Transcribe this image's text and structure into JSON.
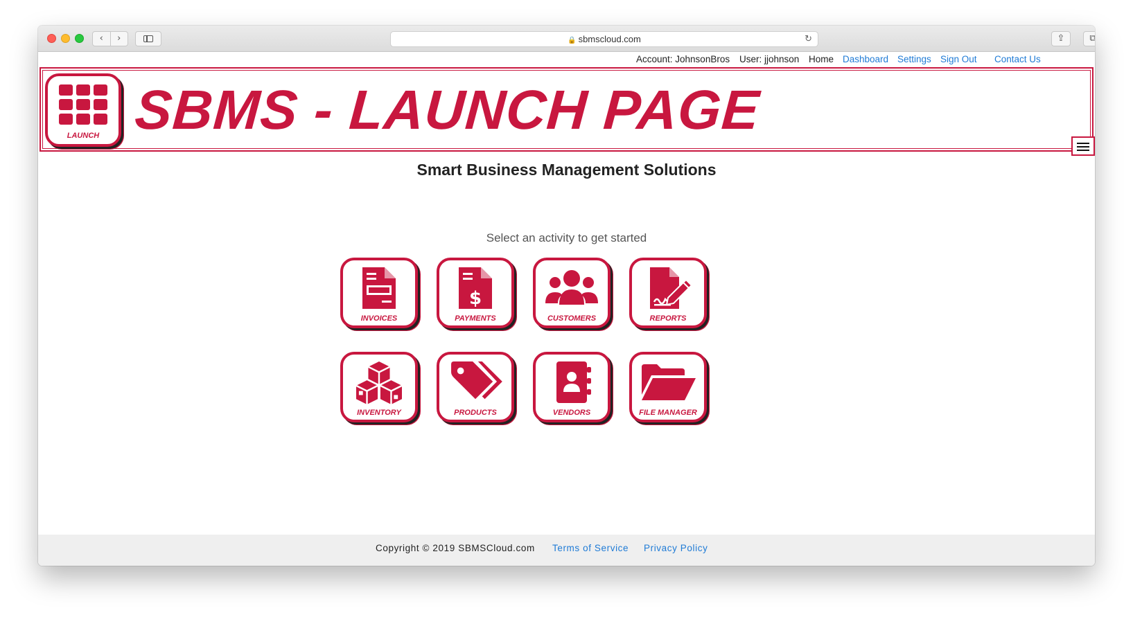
{
  "browser": {
    "url": "sbmscloud.com",
    "back_glyph": "‹",
    "forward_glyph": "›",
    "reload_glyph": "↻",
    "lock_glyph": "🔒",
    "share_glyph": "⇪",
    "tabs_glyph": "⧉",
    "new_tab_glyph": "+"
  },
  "userbar": {
    "account": "Account: JohnsonBros",
    "user": "User: jjohnson",
    "home": "Home",
    "dashboard": "Dashboard",
    "settings": "Settings",
    "sign_out": "Sign Out",
    "contact": "Contact Us"
  },
  "banner": {
    "launch_label": "LAUNCH",
    "title": "SBMS - LAUNCH PAGE"
  },
  "main": {
    "subtitle": "Smart Business Management Solutions",
    "prompt": "Select an activity to get started",
    "tiles": [
      {
        "label": "INVOICES",
        "icon": "invoice-icon"
      },
      {
        "label": "PAYMENTS",
        "icon": "payment-icon"
      },
      {
        "label": "CUSTOMERS",
        "icon": "customers-icon"
      },
      {
        "label": "REPORTS",
        "icon": "report-icon"
      },
      {
        "label": "INVENTORY",
        "icon": "inventory-icon"
      },
      {
        "label": "PRODUCTS",
        "icon": "tags-icon"
      },
      {
        "label": "VENDORS",
        "icon": "address-book-icon"
      },
      {
        "label": "FILE MANAGER",
        "icon": "folder-open-icon"
      }
    ]
  },
  "footer": {
    "copyright": "Copyright © 2019 SBMSCloud.com",
    "terms": "Terms of Service",
    "privacy": "Privacy Policy"
  },
  "colors": {
    "brand": "#c8173f",
    "link": "#1f7bd6"
  }
}
